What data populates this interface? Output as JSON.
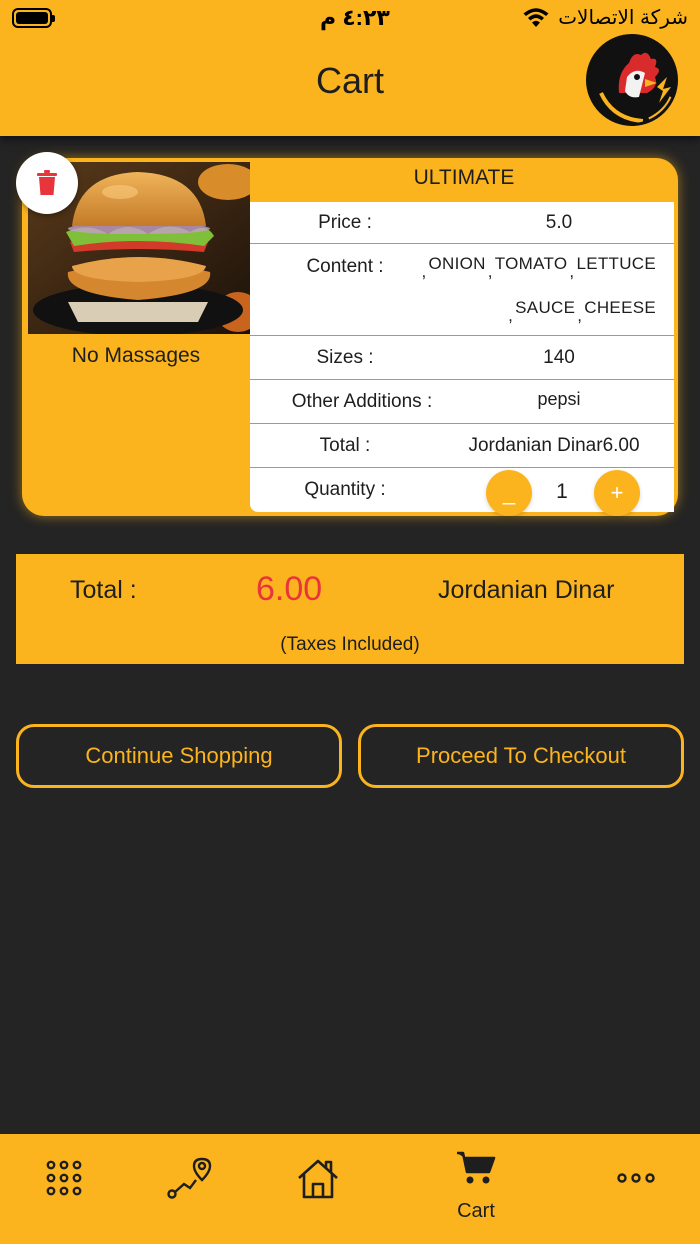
{
  "status_bar": {
    "time": "٤:٢٣ م",
    "carrier": "شركة الاتصالات"
  },
  "header": {
    "title": "Cart",
    "logo_text": "MAMA'S TENDERS"
  },
  "cart_item": {
    "name": "ULTIMATE",
    "message": "No Massages",
    "price_label": "Price :",
    "price_value": "5.0",
    "content_label": "Content :",
    "content_items": [
      "ONION",
      "TOMATO",
      "LETTUCE",
      "SAUCE",
      "CHEESE"
    ],
    "sizes_label": "Sizes :",
    "sizes_value": "140",
    "other_label": "Other Additions :",
    "other_value": "pepsi",
    "total_label": "Total :",
    "total_value": "Jordanian Dinar6.00",
    "quantity_label": "Quantity :",
    "quantity_value": "1",
    "minus_label": "_",
    "plus_label": "+"
  },
  "summary": {
    "total_label": "Total :",
    "total_amount": "6.00",
    "currency": "Jordanian Dinar",
    "taxes_note": "(Taxes Included)"
  },
  "actions": {
    "continue_label": "Continue Shopping",
    "checkout_label": "Proceed To Checkout"
  },
  "tabbar": {
    "cart_label": "Cart"
  },
  "colors": {
    "accent": "#FBB41E",
    "background": "#242424",
    "price_red": "#E8353B",
    "delete_red": "#E8353B"
  },
  "icons": [
    "battery-icon",
    "wifi-icon",
    "trash-icon",
    "grid-icon",
    "route-icon",
    "home-icon",
    "cart-icon",
    "more-icon"
  ]
}
